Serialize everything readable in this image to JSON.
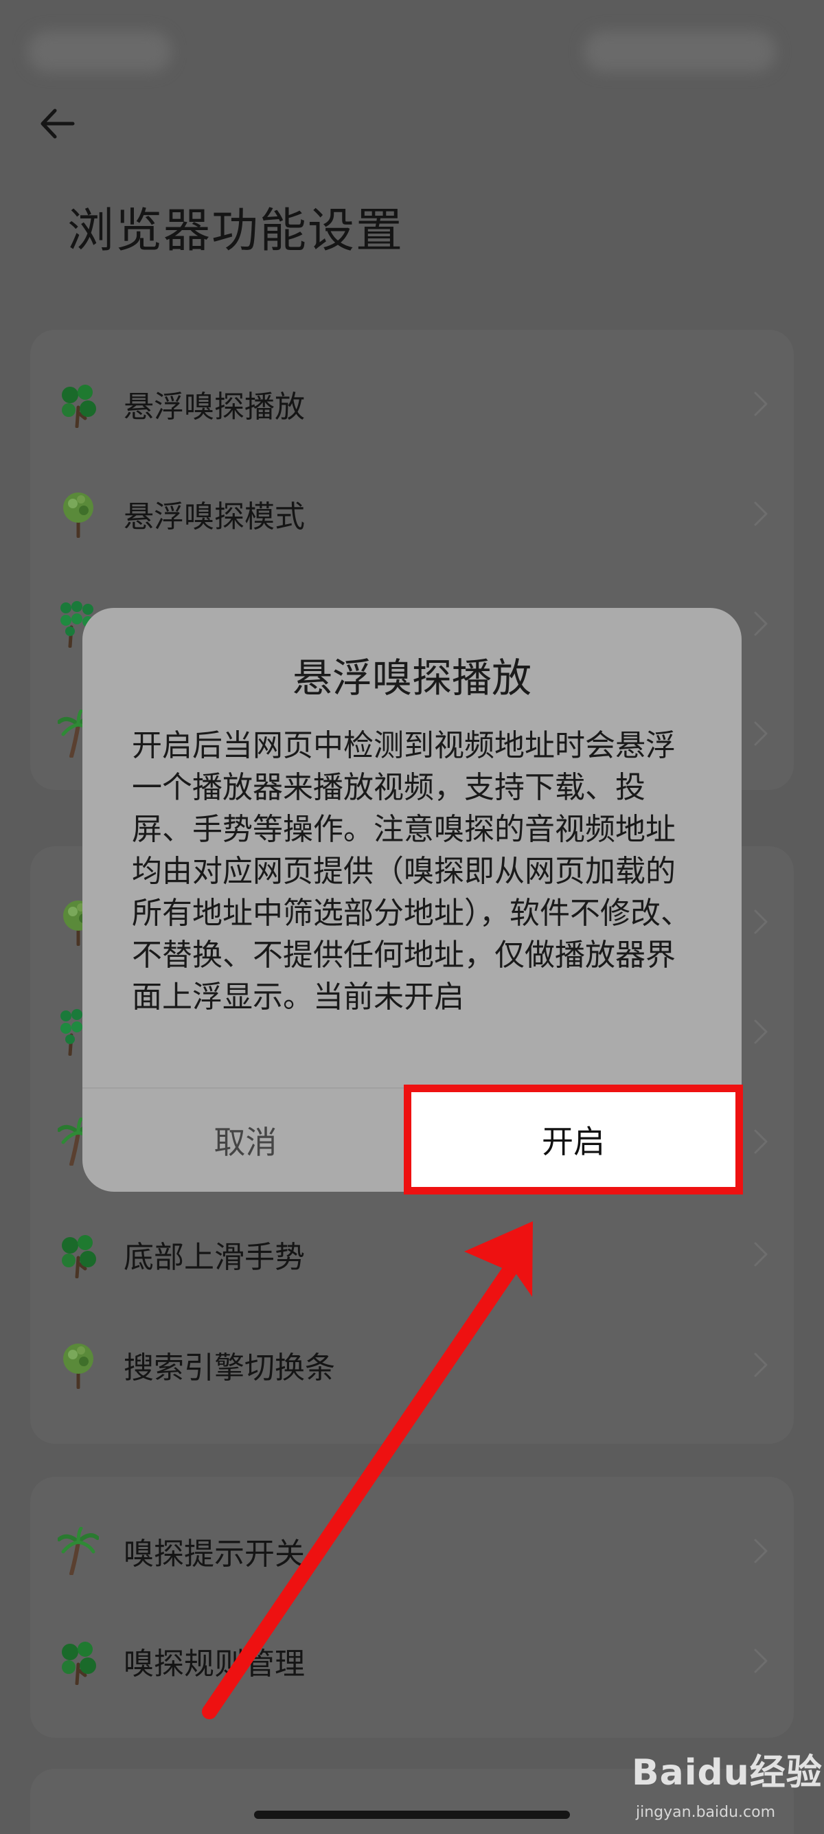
{
  "page": {
    "title": "浏览器功能设置"
  },
  "settings_groups": [
    {
      "items": [
        {
          "label": "悬浮嗅探播放",
          "icon": "tree-icon-round"
        },
        {
          "label": "悬浮嗅探模式",
          "icon": "tree-icon-leafy"
        },
        {
          "label": "",
          "icon": "tree-icon-bushy"
        },
        {
          "label": "",
          "icon": "palm-tree-icon"
        }
      ]
    },
    {
      "items": [
        {
          "label": "",
          "icon": "tree-icon-leafy"
        },
        {
          "label": "",
          "icon": "tree-icon-bushy"
        },
        {
          "label": "",
          "icon": "palm-tree-icon"
        },
        {
          "label": "底部上滑手势",
          "icon": "tree-icon-round"
        },
        {
          "label": "搜索引擎切换条",
          "icon": "tree-icon-leafy"
        }
      ]
    },
    {
      "items": [
        {
          "label": "嗅探提示开关",
          "icon": "palm-tree-icon"
        },
        {
          "label": "嗅探规则管理",
          "icon": "tree-icon-round"
        }
      ]
    }
  ],
  "dialog": {
    "title": "悬浮嗅探播放",
    "message": "开启后当网页中检测到视频地址时会悬浮一个播放器来播放视频，支持下载、投屏、手势等操作。注意嗅探的音视频地址均由对应网页提供（嗅探即从网页加载的所有地址中筛选部分地址），软件不修改、不替换、不提供任何地址，仅做播放器界面上浮显示。当前未开启",
    "cancel_label": "取消",
    "confirm_label": "开启"
  },
  "watermark": {
    "logo": "Baidu经验",
    "url": "jingyan.baidu.com"
  },
  "colors": {
    "highlight": "#ee1111",
    "overlay": "#5c5c5c",
    "dialog": "#ababab"
  }
}
